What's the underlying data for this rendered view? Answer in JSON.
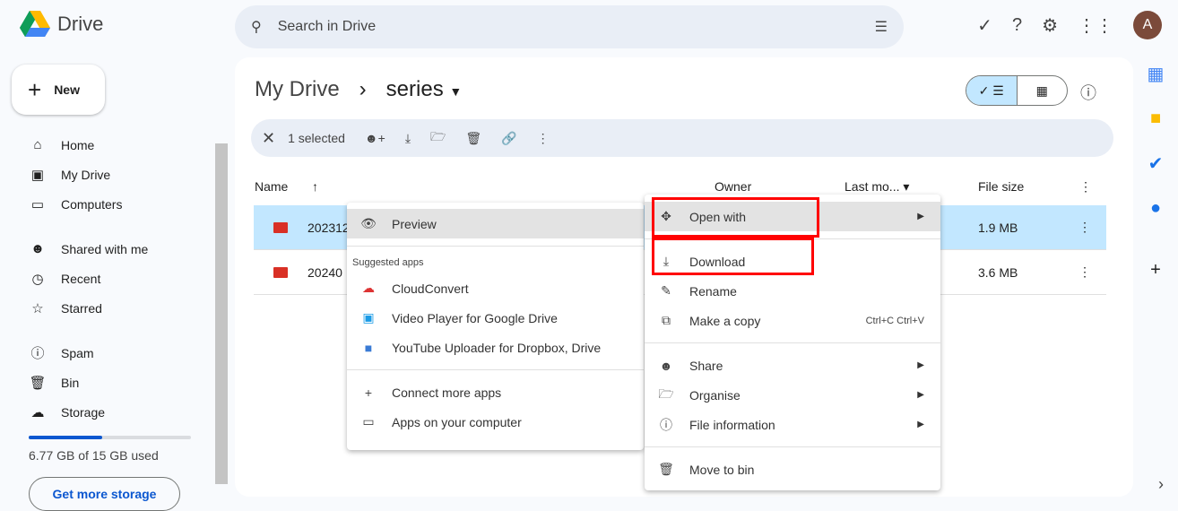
{
  "app": {
    "name": "Drive"
  },
  "search": {
    "placeholder": "Search in Drive"
  },
  "user": {
    "initial": "A"
  },
  "new_label": "New",
  "nav": [
    {
      "label": "Home",
      "icon": "home-icon"
    },
    {
      "label": "My Drive",
      "icon": "drive-icon"
    },
    {
      "label": "Computers",
      "icon": "computer-icon"
    },
    {
      "label": "Shared with me",
      "icon": "people-icon"
    },
    {
      "label": "Recent",
      "icon": "clock-icon"
    },
    {
      "label": "Starred",
      "icon": "star-icon"
    },
    {
      "label": "Spam",
      "icon": "spam-icon"
    },
    {
      "label": "Bin",
      "icon": "trash-icon"
    },
    {
      "label": "Storage",
      "icon": "cloud-icon"
    }
  ],
  "storage": {
    "text": "6.77 GB of 15 GB used",
    "fraction": 0.451,
    "cta": "Get more storage"
  },
  "breadcrumb": {
    "root": "My Drive",
    "sep": "›",
    "current": "series"
  },
  "selection": {
    "label": "1 selected"
  },
  "columns": {
    "name": "Name",
    "owner": "Owner",
    "modified": "Last mo...",
    "size": "File size"
  },
  "files": [
    {
      "name": "202312",
      "size": "1.9 MB",
      "selected": true
    },
    {
      "name": "20240",
      "size": "3.6 MB",
      "selected": false
    }
  ],
  "open_with_menu": {
    "preview": "Preview",
    "suggested": "Suggested apps",
    "apps": [
      "CloudConvert",
      "Video Player for Google Drive",
      "YouTube Uploader for Dropbox, Drive"
    ],
    "connect": "Connect more apps",
    "computer": "Apps on your computer"
  },
  "context_menu": {
    "open_with": "Open with",
    "download": "Download",
    "rename": "Rename",
    "copy": "Make a copy",
    "copy_shortcut": "Ctrl+C Ctrl+V",
    "share": "Share",
    "organise": "Organise",
    "info": "File information",
    "bin": "Move to bin"
  }
}
